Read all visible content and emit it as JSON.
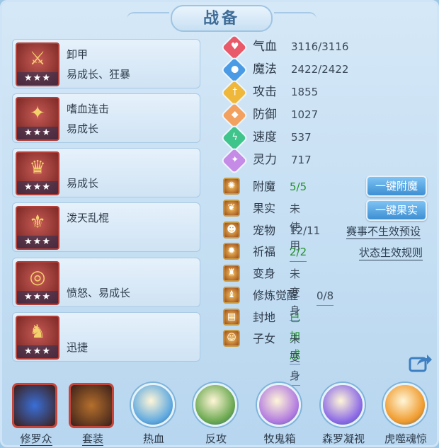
{
  "title": "战备",
  "left_cards": [
    {
      "line1": "卸甲",
      "line2": "易成长、狂暴",
      "stars": "★★★",
      "glyph": "⚔"
    },
    {
      "line1": "嗜血连击",
      "line2": "易成长",
      "stars": "★★★",
      "glyph": "✦"
    },
    {
      "line1": "",
      "line2": "易成长",
      "stars": "★★★",
      "glyph": "♛"
    },
    {
      "line1": "泼天乱棍",
      "line2": "",
      "stars": "★★★",
      "glyph": "⚜"
    },
    {
      "line1": "",
      "line2": "愤怒、易成长",
      "stars": "★★★",
      "glyph": "◎"
    },
    {
      "line1": "",
      "line2": "迅捷",
      "stars": "★★★",
      "glyph": "♞"
    }
  ],
  "stats": [
    {
      "label": "气血",
      "value": "3116/3116",
      "icon": "heart-icon",
      "color": "#e85a6a",
      "glyph": "♥"
    },
    {
      "label": "魔法",
      "value": "2422/2422",
      "icon": "drop-icon",
      "color": "#4a9be6",
      "glyph": "●"
    },
    {
      "label": "攻击",
      "value": "1855",
      "icon": "sword-icon",
      "color": "#f0b83a",
      "glyph": "†"
    },
    {
      "label": "防御",
      "value": "1027",
      "icon": "shield-icon",
      "color": "#f2a160",
      "glyph": "◆"
    },
    {
      "label": "速度",
      "value": "537",
      "icon": "lightning-icon",
      "color": "#3fc48c",
      "glyph": "ϟ"
    },
    {
      "label": "灵力",
      "value": "717",
      "icon": "spirit-icon",
      "color": "#c58be6",
      "glyph": "✦"
    }
  ],
  "features": [
    {
      "label": "附魔",
      "value": "5/5",
      "green": true,
      "underline": false,
      "glyph": "✺"
    },
    {
      "label": "果实",
      "value": "未使用",
      "green": false,
      "underline": false,
      "glyph": "❦"
    },
    {
      "label": "宠物",
      "value": "12/11",
      "green": false,
      "underline": false,
      "glyph": "☻"
    },
    {
      "label": "祈福",
      "value": "2/2",
      "green": true,
      "underline": true,
      "glyph": "✹"
    },
    {
      "label": "变身",
      "value": "未变身",
      "green": false,
      "underline": true,
      "glyph": "♜"
    },
    {
      "label": "修炼觉醒",
      "value": "0/8",
      "green": false,
      "underline": true,
      "glyph": "♝"
    },
    {
      "label": "封地",
      "value": "已加成",
      "green": true,
      "underline": true,
      "glyph": "▤"
    },
    {
      "label": "子女",
      "value": "未变身",
      "green": false,
      "underline": true,
      "glyph": "☺"
    }
  ],
  "buttons": {
    "enchant_all": "一键附魔",
    "fruit_all": "一键果实"
  },
  "links": {
    "event_preset": "赛事不生效预设",
    "status_rules": "状态生效规则"
  },
  "bottom_bar": [
    {
      "label": "修罗众",
      "style": "square",
      "underline": true,
      "color": "#3a6fd8"
    },
    {
      "label": "套装",
      "style": "square",
      "underline": true,
      "color": "#b5702c"
    },
    {
      "label": "热血",
      "style": "circle",
      "underline": false,
      "color": "#5fa9e0"
    },
    {
      "label": "反攻",
      "style": "circle",
      "underline": false,
      "color": "#6aa84f"
    },
    {
      "label": "牧鬼箱",
      "style": "circle",
      "underline": false,
      "color": "#b27ae0"
    },
    {
      "label": "森罗凝视",
      "style": "circle",
      "underline": false,
      "color": "#8c6ae6"
    },
    {
      "label": "虎噬魂惊",
      "style": "circle",
      "underline": false,
      "color": "#f09a2c"
    }
  ]
}
